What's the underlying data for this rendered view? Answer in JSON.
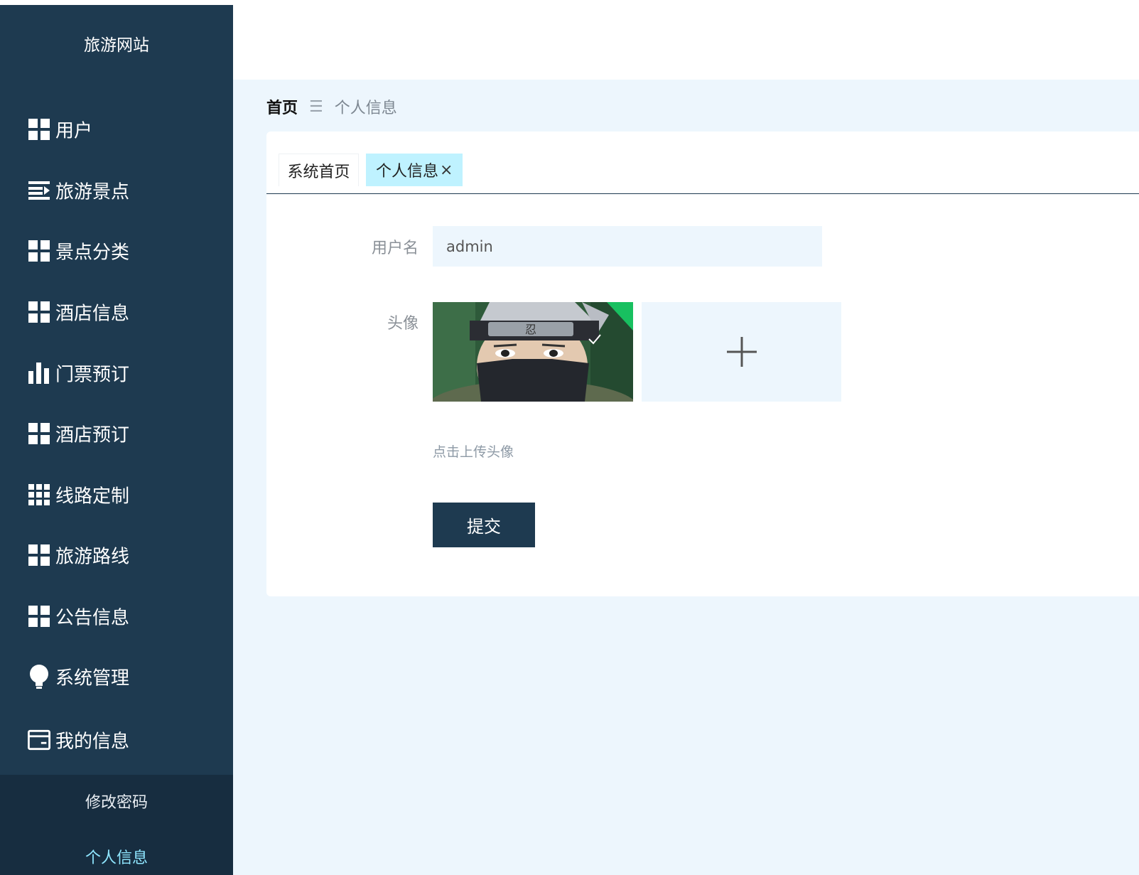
{
  "sidebar": {
    "brand": "旅游网站",
    "items": [
      {
        "label": "用户",
        "icon": "grid-icon"
      },
      {
        "label": "旅游景点",
        "icon": "list-icon"
      },
      {
        "label": "景点分类",
        "icon": "grid-icon"
      },
      {
        "label": "酒店信息",
        "icon": "grid-icon"
      },
      {
        "label": "门票预订",
        "icon": "bar-chart-icon"
      },
      {
        "label": "酒店预订",
        "icon": "grid-icon"
      },
      {
        "label": "线路定制",
        "icon": "grid-3x3-icon"
      },
      {
        "label": "旅游路线",
        "icon": "grid-icon"
      },
      {
        "label": "公告信息",
        "icon": "grid-icon"
      },
      {
        "label": "系统管理",
        "icon": "bulb-icon"
      },
      {
        "label": "我的信息",
        "icon": "wallet-icon"
      }
    ],
    "submenu": [
      {
        "label": "修改密码",
        "active": false
      },
      {
        "label": "个人信息",
        "active": true
      }
    ]
  },
  "breadcrumb": {
    "home": "首页",
    "separator": "☰",
    "current": "个人信息"
  },
  "tabs": [
    {
      "label": "系统首页",
      "active": false
    },
    {
      "label": "个人信息",
      "active": true,
      "close": "×"
    }
  ],
  "form": {
    "username_label": "用户名",
    "username_value": "admin",
    "avatar_label": "头像",
    "upload_hint": "点击上传头像",
    "submit_label": "提交"
  },
  "colors": {
    "sidebar_bg": "#1e3a50",
    "submenu_bg": "#172d40",
    "active_sub": "#8fe6ff",
    "main_bg": "#edf6fd",
    "active_tab": "#bff2ff",
    "button_bg": "#1e3a50"
  }
}
